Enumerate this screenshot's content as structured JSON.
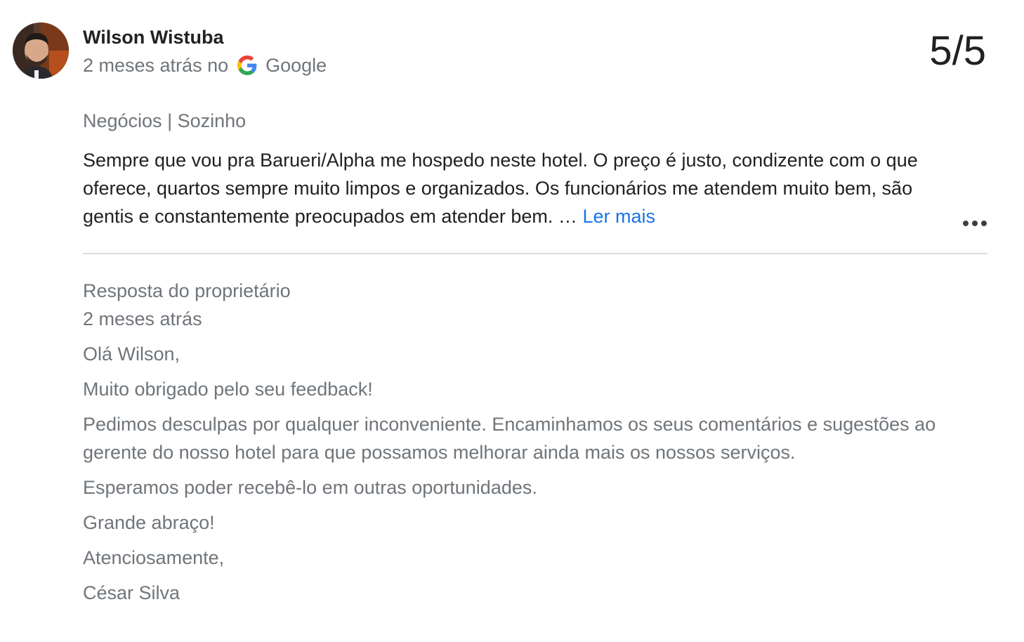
{
  "review": {
    "author": "Wilson Wistuba",
    "time_ago": "2 meses atrás no",
    "source": "Google",
    "score": "5/5",
    "trip_type": "Negócios | Sozinho",
    "text": "Sempre que vou pra Barueri/Alpha me hospedo neste hotel. O preço é justo, condizente com o que oferece, quartos sempre muito limpos e organizados. Os funcionários me atendem muito bem, são gentis e constantemente preocupados em atender bem. …",
    "read_more": "Ler mais",
    "more_options_icon": "more-horiz-icon"
  },
  "owner_reply": {
    "title": "Resposta do proprietário",
    "time_ago": "2 meses atrás",
    "paragraphs": [
      "Olá Wilson,",
      "Muito obrigado pelo seu feedback!",
      "Pedimos desculpas por qualquer inconveniente. Encaminhamos os seus comentários e sugestões ao gerente do nosso hotel para que possamos melhorar ainda mais os nossos serviços.",
      "Esperamos poder recebê-lo em outras oportunidades.",
      "Grande abraço!",
      "Atenciosamente,",
      "César Silva"
    ]
  },
  "colors": {
    "link": "#1a73e8",
    "secondary_text": "#70757a",
    "primary_text": "#202124",
    "divider": "#dadce0"
  }
}
